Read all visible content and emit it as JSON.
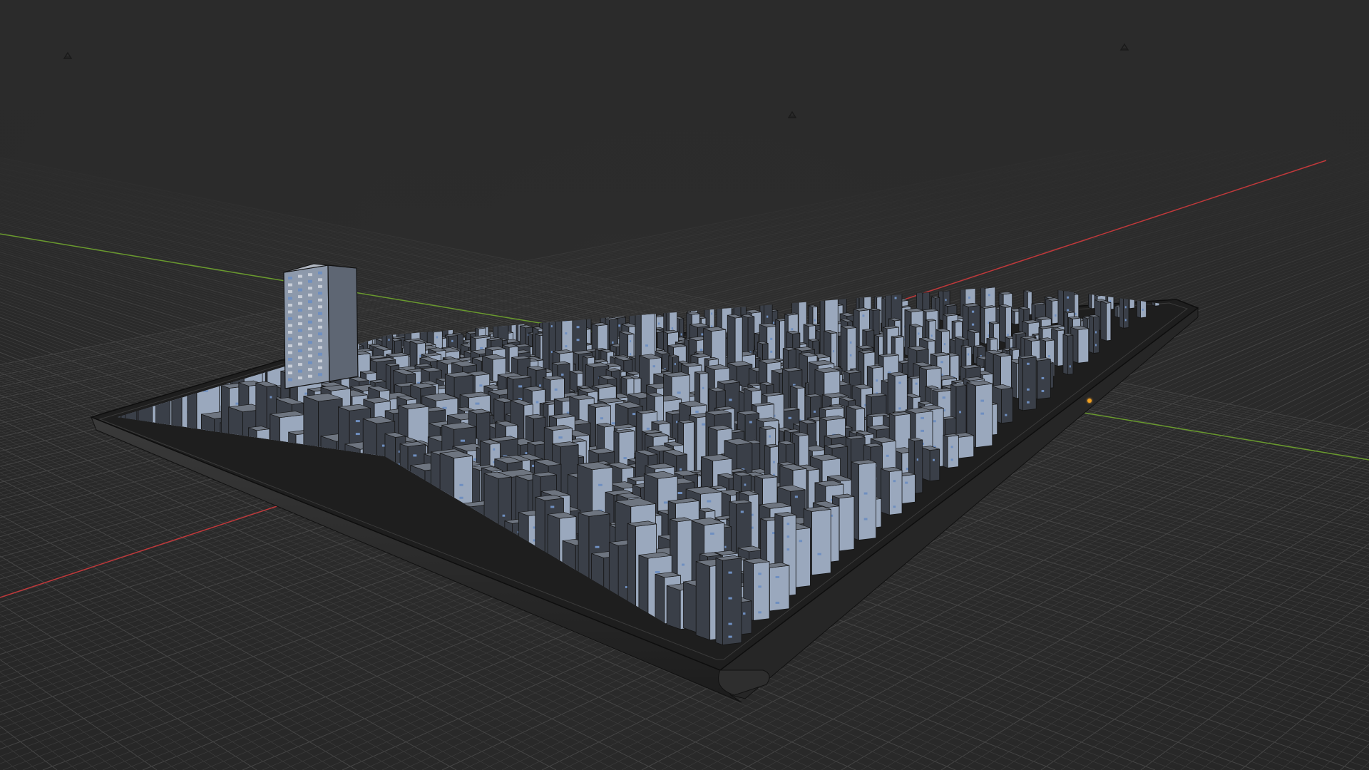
{
  "viewport": {
    "name": "3d-viewport",
    "background_color": "#2b2b2b",
    "grid_color": "#3c3c3c",
    "grid_major_color": "#454545",
    "axis_x_color": "#c0393b",
    "axis_y_color": "#6a9a2e"
  },
  "scene": {
    "objects": [
      {
        "name": "city-model",
        "type": "mesh",
        "selected": false
      },
      {
        "name": "city-base-slab",
        "type": "mesh",
        "selected": false
      },
      {
        "name": "light-1",
        "type": "light",
        "icon": "light-icon"
      },
      {
        "name": "light-2",
        "type": "light",
        "icon": "light-icon"
      },
      {
        "name": "light-3",
        "type": "light",
        "icon": "light-icon"
      }
    ],
    "origin_marker_color": "#f0a020",
    "building_colors": {
      "wall_light": "#9aa8bd",
      "wall_dark": "#3a3f48",
      "window_blue": "#6f8fc0",
      "edge": "#141414"
    }
  }
}
